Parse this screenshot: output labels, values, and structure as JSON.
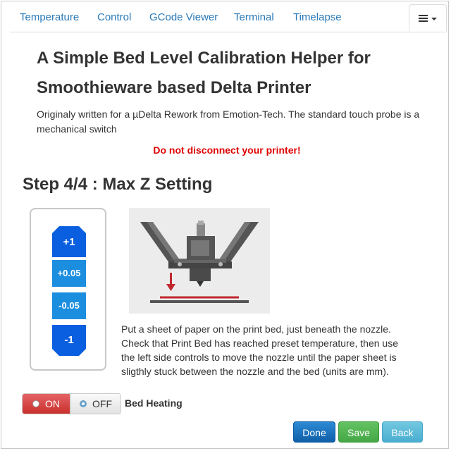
{
  "tabs": [
    {
      "label": "Temperature"
    },
    {
      "label": "Control"
    },
    {
      "label": "GCode Viewer"
    },
    {
      "label": "Terminal"
    },
    {
      "label": "Timelapse"
    }
  ],
  "header": {
    "title_line1": "A Simple Bed Level Calibration Helper for",
    "title_line2": "Smoothieware based Delta Printer",
    "intro": "Originaly written for a µDelta Rework from Emotion-Tech. The standard touch probe is a mechanical switch",
    "warning": "Do not disconnect your printer!",
    "warning_color": "#e00000"
  },
  "step": {
    "title": "Step 4/4 : Max Z Setting"
  },
  "z_controls": [
    {
      "label": "+1",
      "color": "#0a5ee0",
      "shape": "arrow-up"
    },
    {
      "label": "+0.05",
      "color": "#1c8ee0",
      "shape": "square"
    },
    {
      "label": "-0.05",
      "color": "#1c8ee0",
      "shape": "square"
    },
    {
      "label": "-1",
      "color": "#0a5ee0",
      "shape": "arrow-down"
    }
  ],
  "instructions": "Put a sheet of paper on the print bed, just beneath the nozzle. Check that Print Bed has reached preset temperature, then use the left side controls to move the nozzle until the paper sheet is sligthly stuck between the nozzle and the bed (units are mm).",
  "bed_heating": {
    "on_label": "ON",
    "off_label": "OFF",
    "selected": "OFF",
    "label": "Bed Heating"
  },
  "footer": {
    "done_label": "Done",
    "save_label": "Save",
    "back_label": "Back"
  },
  "colors": {
    "tab_link": "#2a7ab8",
    "done": "#1a73c4",
    "save": "#55b555",
    "back": "#5bbad8",
    "toggle_on": "#d9403d"
  },
  "icons": {
    "menu": "list-menu-icon",
    "radio_on": "radio-unchecked-icon",
    "radio_off": "radio-checked-icon"
  }
}
